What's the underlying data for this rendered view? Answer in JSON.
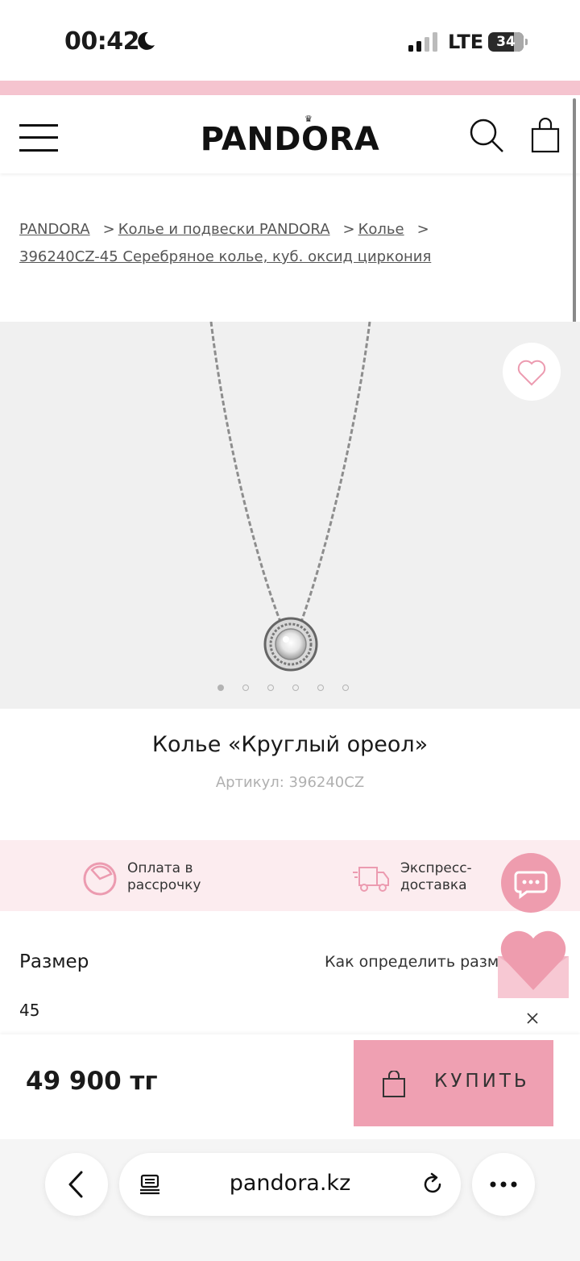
{
  "status_bar": {
    "time": "00:42",
    "network": "LTE",
    "battery": "34"
  },
  "header": {
    "logo": "PANDORA"
  },
  "breadcrumb": {
    "items": [
      "PANDORA",
      "Колье и подвески PANDORA",
      "Колье",
      "396240CZ-45 Серебряное колье, куб. оксид циркония"
    ]
  },
  "product": {
    "title": "Колье «Круглый ореол»",
    "sku": "Артикул: 396240CZ",
    "gallery_pages": 6,
    "gallery_active": 1
  },
  "benefits": [
    {
      "icon": "installment-icon",
      "line1": "Оплата в",
      "line2": "рассрочку"
    },
    {
      "icon": "delivery-truck-icon",
      "line1": "Экспресс-",
      "line2": "доставка"
    }
  ],
  "size": {
    "label": "Размер",
    "help_link": "Как определить размер",
    "value": "45"
  },
  "purchase": {
    "price": "49 900 тг",
    "buy_label": "КУПИТЬ"
  },
  "browser": {
    "url": "pandora.kz"
  },
  "colors": {
    "accent_pink": "#efa0b2",
    "light_pink": "#fcecef",
    "promo_pink": "#f5c4cf"
  }
}
